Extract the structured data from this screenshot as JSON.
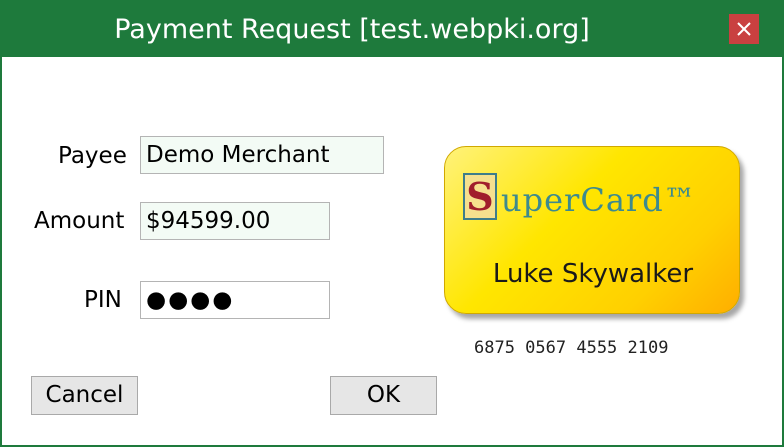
{
  "window": {
    "title": "Payment Request [test.webpki.org]",
    "close_icon": "close-icon"
  },
  "form": {
    "payee_label": "Payee",
    "payee_value": "Demo Merchant",
    "amount_label": "Amount",
    "amount_value": "$94599.00",
    "pin_label": "PIN",
    "pin_value": "●●●●"
  },
  "card": {
    "logo_letter": "S",
    "brand": "uperCard™",
    "holder": "Luke Skywalker",
    "number": "6875 0567 4555 2109"
  },
  "buttons": {
    "cancel_label": "Cancel",
    "ok_label": "OK"
  },
  "colors": {
    "titlebar": "#1e7a3c",
    "close_button": "#c94040",
    "card_yellow": "#ffe600",
    "logo_red": "#a01e2c",
    "brand_teal": "#3d8a8e"
  }
}
